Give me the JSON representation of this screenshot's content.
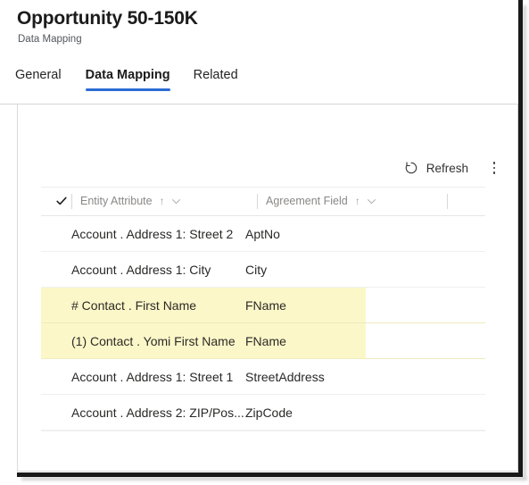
{
  "header": {
    "title": "Opportunity 50-150K",
    "subtitle": "Data Mapping"
  },
  "tabs": [
    {
      "label": "General",
      "active": false
    },
    {
      "label": "Data Mapping",
      "active": true
    },
    {
      "label": "Related",
      "active": false
    }
  ],
  "command_bar": {
    "refresh_label": "Refresh",
    "refresh_icon": "refresh-circular-arrow-icon",
    "overflow_icon": "kebab-more-icon"
  },
  "grid": {
    "select_all_icon": "checkmark-icon",
    "sort_indicator": "↑",
    "filter_icon": "chevron-down-icon",
    "columns": [
      {
        "label": "Entity Attribute",
        "sorted": "ascending"
      },
      {
        "label": "Agreement Field",
        "sorted": "ascending"
      }
    ],
    "rows": [
      {
        "entity_attribute": "Account . Address 1: Street 2",
        "agreement_field": "AptNo",
        "highlighted": false
      },
      {
        "entity_attribute": "Account . Address 1: City",
        "agreement_field": "City",
        "highlighted": false
      },
      {
        "entity_attribute": "# Contact . First Name",
        "agreement_field": "FName",
        "highlighted": true
      },
      {
        "entity_attribute": "(1) Contact . Yomi First Name",
        "agreement_field": "FName",
        "highlighted": true
      },
      {
        "entity_attribute": "Account . Address 1: Street 1",
        "agreement_field": "StreetAddress",
        "highlighted": false
      },
      {
        "entity_attribute": "Account . Address 2: ZIP/Pos...",
        "agreement_field": "ZipCode",
        "highlighted": false
      }
    ]
  },
  "colors": {
    "accent_blue": "#2b6cd4",
    "highlight_yellow": "#fcf7c9",
    "text_primary": "#292827",
    "text_secondary": "#8a8886"
  }
}
